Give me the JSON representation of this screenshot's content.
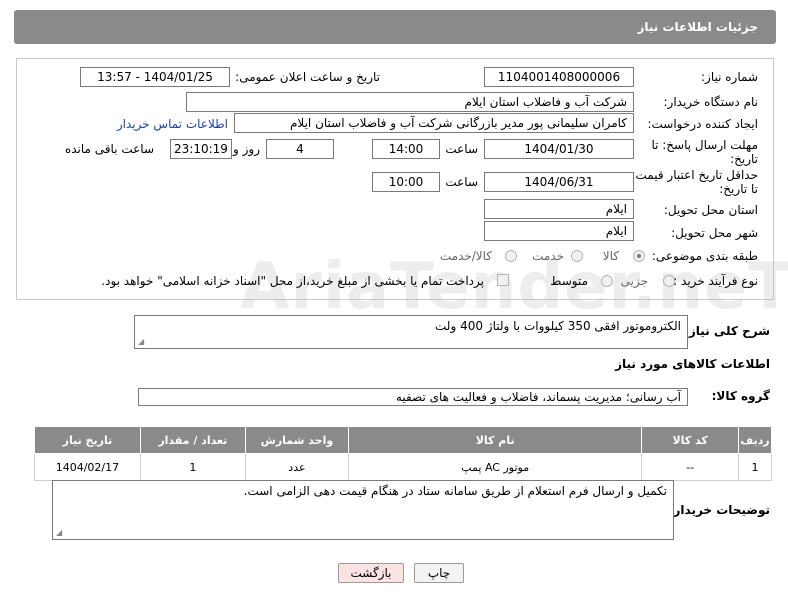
{
  "header": {
    "title": "جزئیات اطلاعات نیاز"
  },
  "fields": {
    "need_number_label": "شماره نیاز:",
    "need_number": "1104001408000006",
    "announce_datetime_label": "تاریخ و ساعت اعلان عمومی:",
    "announce_datetime": "1404/01/25 - 13:57",
    "buyer_org_label": "نام دستگاه خریدار:",
    "buyer_org": "شرکت آب و فاضلاب استان ایلام",
    "requester_label": "ایجاد کننده درخواست:",
    "requester": "کامران سلیمانی پور مدیر بازرگانی شرکت آب و فاضلاب استان ایلام",
    "buyer_contact_link": "اطلاعات تماس خریدار",
    "reply_deadline_label_1": "مهلت ارسال پاسخ: تا",
    "reply_deadline_label_2": "تاریخ:",
    "reply_date": "1404/01/30",
    "time_label": "ساعت",
    "reply_time": "14:00",
    "days_count": "4",
    "days_label": "روز و",
    "remaining_time": "23:10:19",
    "remaining_label": "ساعت باقی مانده",
    "price_validity_label_1": "حداقل تاریخ اعتبار قیمت:",
    "price_validity_label_2": "تا تاریخ:",
    "price_validity_date": "1404/06/31",
    "price_validity_time": "10:00",
    "delivery_province_label": "استان محل تحویل:",
    "delivery_province": "ایلام",
    "delivery_city_label": "شهر محل تحویل:",
    "delivery_city": "ایلام",
    "category_label": "طبقه بندی موضوعی:",
    "category_options": [
      "کالا",
      "خدمت",
      "کالا/خدمت"
    ],
    "category_selected": "کالا",
    "process_label": "نوع فرآیند خرید :",
    "process_options": [
      "جزیی",
      "متوسط"
    ],
    "payment_note": "پرداخت تمام یا بخشی از مبلغ خرید،از محل \"اسناد خزانه اسلامی\" خواهد بود."
  },
  "description": {
    "label": "شرح کلی نیاز:",
    "text": "الکتروموتور افقی 350 کیلووات با ولتاژ 400 ولت"
  },
  "goods_section": {
    "title": "اطلاعات کالاهای مورد نیاز",
    "group_label": "گروه کالا:",
    "group_value": "آب رسانی؛ مدیریت پسماند، فاضلاب و فعالیت های تصفیه"
  },
  "table": {
    "headers": [
      "ردیف",
      "کد کالا",
      "نام کالا",
      "واحد شمارش",
      "تعداد / مقدار",
      "تاریخ نیاز"
    ],
    "rows": [
      [
        "1",
        "--",
        "موتور AC پمپ",
        "عدد",
        "1",
        "1404/02/17"
      ]
    ]
  },
  "buyer_notes": {
    "label": "توضیحات خریدار:",
    "text": "تکمیل و ارسال فرم استعلام از طریق سامانه ستاد در هنگام قیمت دهی الزامی است."
  },
  "buttons": {
    "print": "چاپ",
    "back": "بازگشت"
  },
  "watermark": "AriaTender.neT"
}
